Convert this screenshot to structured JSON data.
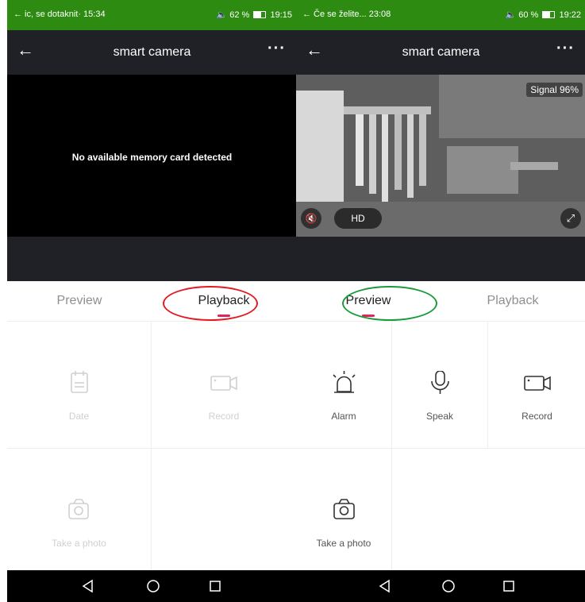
{
  "left_screen": {
    "status": {
      "left": "← ic, se dotaknit· 15:34",
      "right": "62 %",
      "time": "19:15",
      "battery_level": 0.62
    },
    "header": {
      "title": "smart camera"
    },
    "video": {
      "message": "No available memory card detected"
    },
    "tabs": [
      {
        "label": "Preview",
        "active": false
      },
      {
        "label": "Playback",
        "active": true
      }
    ],
    "actions": [
      {
        "label": "Date",
        "icon": "calendar-icon",
        "enabled": false
      },
      {
        "label": "Record",
        "icon": "video-camera-icon",
        "enabled": false
      },
      {
        "label": "Take a photo",
        "icon": "camera-icon",
        "enabled": false
      }
    ],
    "highlight_color": "#e01b24"
  },
  "right_screen": {
    "status": {
      "left": "← Če se želite... 23:08",
      "right": "60 %",
      "time": "19:22",
      "battery_level": 0.6
    },
    "header": {
      "title": "smart camera"
    },
    "video": {
      "signal": "Signal  96%",
      "quality": "HD"
    },
    "tabs": [
      {
        "label": "Preview",
        "active": true
      },
      {
        "label": "Playback",
        "active": false
      }
    ],
    "actions": [
      {
        "label": "Alarm",
        "icon": "siren-icon",
        "enabled": true
      },
      {
        "label": "Speak",
        "icon": "microphone-icon",
        "enabled": true
      },
      {
        "label": "Record",
        "icon": "video-camera-icon",
        "enabled": true
      },
      {
        "label": "Take a photo",
        "icon": "camera-icon",
        "enabled": true
      }
    ],
    "highlight_color": "#1a9a3a"
  },
  "colors": {
    "status_bar": "#2e8b12",
    "app_bar": "#1f2126",
    "tab_indicator": "#e0245e"
  }
}
